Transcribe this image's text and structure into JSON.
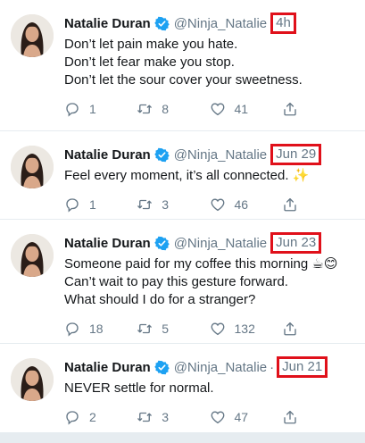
{
  "accent": "#1da1f2",
  "highlight_color": "#e0101a",
  "tweets": [
    {
      "name": "Natalie Duran",
      "handle": "@Ninja_Natalie",
      "separator": "",
      "time": "4h",
      "lines": [
        "Don’t let pain make you hate.",
        "Don’t let fear make you stop.",
        "Don’t let the sour cover your sweetness."
      ],
      "replies": "1",
      "retweets": "8",
      "likes": "41"
    },
    {
      "name": "Natalie Duran",
      "handle": "@Ninja_Natalie",
      "separator": "",
      "time": "Jun 29",
      "lines": [
        "Feel every moment, it’s all connected. ✨"
      ],
      "replies": "1",
      "retweets": "3",
      "likes": "46"
    },
    {
      "name": "Natalie Duran",
      "handle": "@Ninja_Natalie",
      "separator": "",
      "time": "Jun 23",
      "lines": [
        "Someone paid for my coffee this morning ☕😊",
        "Can’t wait to pay this gesture forward.",
        "What should I do for a stranger?"
      ],
      "replies": "18",
      "retweets": "5",
      "likes": "132"
    },
    {
      "name": "Natalie Duran",
      "handle": "@Ninja_Natalie",
      "separator": "·",
      "time": "Jun 21",
      "lines": [
        "NEVER settle for normal."
      ],
      "replies": "2",
      "retweets": "3",
      "likes": "47"
    }
  ],
  "icons": {
    "verified": "verified-badge-icon",
    "reply": "reply-icon",
    "retweet": "retweet-icon",
    "like": "heart-icon",
    "share": "share-icon"
  }
}
